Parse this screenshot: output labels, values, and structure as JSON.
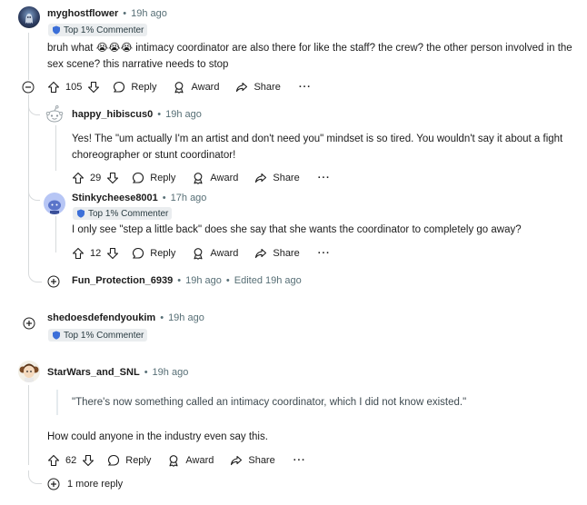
{
  "comments": {
    "c1": {
      "username": "myghostflower",
      "time": "19h ago",
      "badge": "Top 1% Commenter",
      "body": "bruh what 😭😭😭 intimacy coordinator are also there for like the staff? the crew? the other person involved in the sex scene? this narrative needs to stop",
      "votes": "105",
      "reply": "Reply",
      "award": "Award",
      "share": "Share",
      "more": "···"
    },
    "c2": {
      "username": "happy_hibiscus0",
      "time": "19h ago",
      "body": "Yes! The \"um actually I'm an artist and don't need you\" mindset is so tired. You wouldn't say it about a fight choreographer or stunt coordinator!",
      "votes": "29",
      "reply": "Reply",
      "award": "Award",
      "share": "Share",
      "more": "···"
    },
    "c3": {
      "username": "Stinkycheese8001",
      "time": "17h ago",
      "badge": "Top 1% Commenter",
      "body": "I only see \"step a little back\" does she say that she wants the coordinator to completely go away?",
      "votes": "12",
      "reply": "Reply",
      "award": "Award",
      "share": "Share",
      "more": "···"
    },
    "c4": {
      "username": "Fun_Protection_6939",
      "time": "19h ago",
      "edited": "Edited 19h ago"
    },
    "c5": {
      "username": "shedoesdefendyoukim",
      "time": "19h ago",
      "badge": "Top 1% Commenter"
    },
    "c6": {
      "username": "StarWars_and_SNL",
      "time": "19h ago",
      "quote": "\"There's now something called an intimacy coordinator, which I did not know existed.\"",
      "body": "How could anyone in the industry even say this.",
      "votes": "62",
      "reply": "Reply",
      "award": "Award",
      "share": "Share",
      "more": "···",
      "more_replies": "1 more reply"
    }
  },
  "separator": "•",
  "colors": {
    "thread_line": "#d7dadc",
    "meta_text": "#576f76",
    "badge_bg": "#eaedef"
  }
}
